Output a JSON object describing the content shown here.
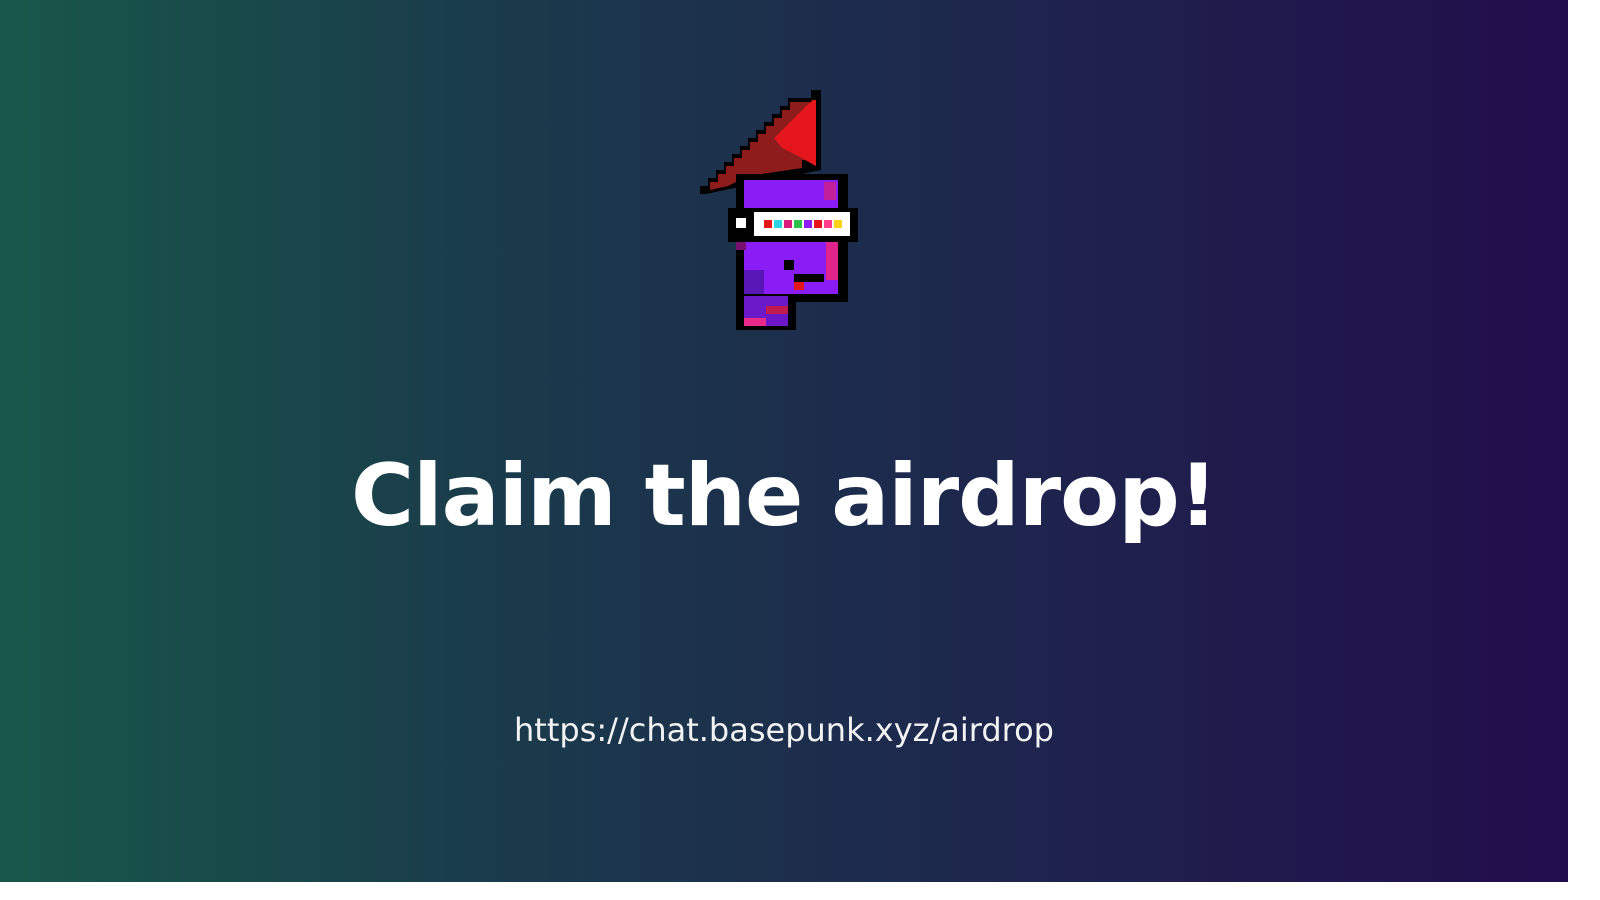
{
  "headline": "Claim the airdrop!",
  "url": "https://chat.basepunk.xyz/airdrop",
  "mascot_icon": "pixel-punk-mascot-icon",
  "colors": {
    "background_left": "#18574a",
    "background_right": "#220d4c",
    "text": "#ffffff",
    "hat": "#e0141a",
    "face": "#8a1cf5",
    "visor": "#ffffff"
  }
}
